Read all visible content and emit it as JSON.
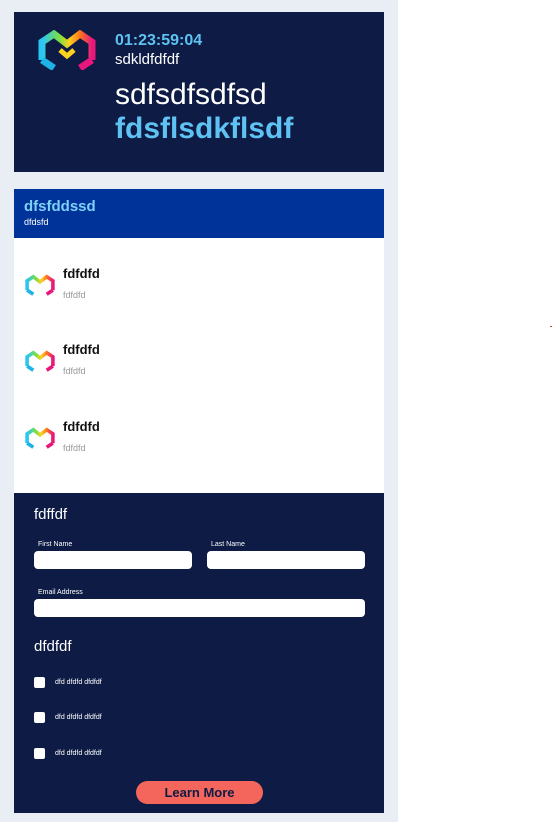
{
  "colors": {
    "navy": "#0d1b45",
    "banner_blue": "#003399",
    "accent_cyan": "#5ec3f2",
    "cta_coral": "#f4665b"
  },
  "hero": {
    "logo_icon": "m-logo-icon",
    "timer": "01:23:59:04",
    "subtitle": "sdkldfdfdf",
    "title": "sdfsdfsdfsd",
    "title_accent": "fdsflsdkflsdf"
  },
  "banner": {
    "title": "dfsfddssd",
    "subtitle": "dfdsfd"
  },
  "list": {
    "items": [
      {
        "icon": "m-logo-icon",
        "title": "fdfdfd",
        "subtitle": "fdfdfd"
      },
      {
        "icon": "m-logo-icon",
        "title": "fdfdfd",
        "subtitle": "fdfdfd"
      },
      {
        "icon": "m-logo-icon",
        "title": "fdfdfd",
        "subtitle": "fdfdfd"
      }
    ]
  },
  "form": {
    "heading": "fdffdf",
    "first_name_label": "First Name",
    "first_name_value": "",
    "last_name_label": "Last Name",
    "last_name_value": "",
    "email_label": "Email Address",
    "email_value": "",
    "options_heading": "dfdfdf",
    "options": [
      {
        "label": "dfd dfdfd dfdfdf",
        "checked": false
      },
      {
        "label": "dfd dfdfd dfdfdf",
        "checked": false
      },
      {
        "label": "dfd dfdfd dfdfdf",
        "checked": false
      }
    ],
    "cta_label": "Learn More"
  }
}
